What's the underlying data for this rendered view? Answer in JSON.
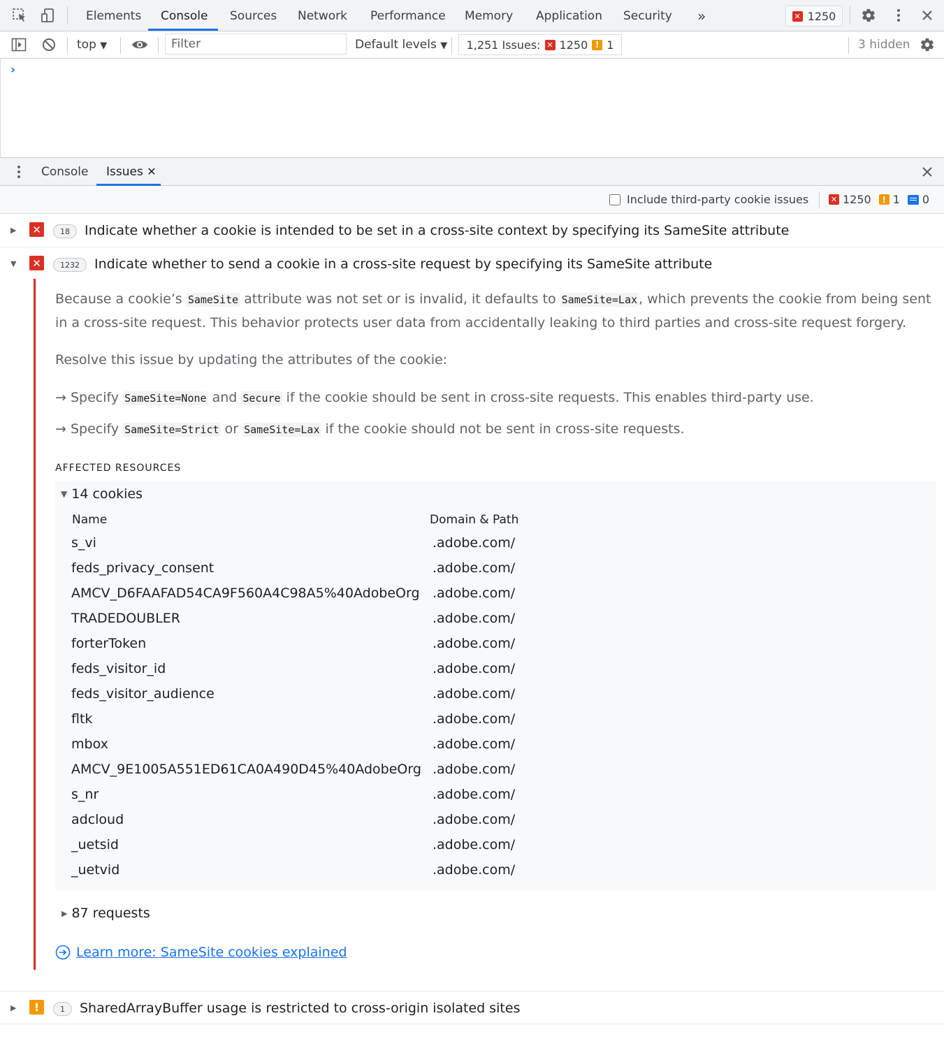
{
  "tabs": [
    {
      "label": "Elements"
    },
    {
      "label": "Console"
    },
    {
      "label": "Sources"
    },
    {
      "label": "Network"
    },
    {
      "label": "Performance"
    },
    {
      "label": "Memory"
    },
    {
      "label": "Application"
    },
    {
      "label": "Security"
    }
  ],
  "active_tab": "Console",
  "error_badge_count": "1250",
  "toolbar": {
    "context": "top",
    "filter_placeholder": "Filter",
    "levels": "Default levels",
    "issues_label": "1,251 Issues:",
    "issues_errors": "1250",
    "issues_warnings": "1",
    "hidden": "3 hidden"
  },
  "drawer": {
    "tabs": [
      {
        "label": "Console"
      },
      {
        "label": "Issues"
      }
    ],
    "active_tab": "Issues",
    "include_label": "Include third-party cookie issues",
    "count_errors": "1250",
    "count_warnings": "1",
    "count_info": "0"
  },
  "issues": [
    {
      "count": "18",
      "title": "Indicate whether a cookie is intended to be set in a cross-site context by specifying its SameSite attribute",
      "severity": "error",
      "expanded": false
    },
    {
      "count": "1232",
      "title": "Indicate whether to send a cookie in a cross-site request by specifying its SameSite attribute",
      "severity": "error",
      "expanded": true
    },
    {
      "count": "1",
      "title": "SharedArrayBuffer usage is restricted to cross-origin isolated sites",
      "severity": "warning",
      "expanded": false
    }
  ],
  "detail": {
    "p1_a": "Because a cookie’s ",
    "p1_code1": "SameSite",
    "p1_b": " attribute was not set or is invalid, it defaults to ",
    "p1_code2": "SameSite=Lax",
    "p1_c": ", which prevents the cookie from being sent in a cross-site request. This behavior protects user data from accidentally leaking to third parties and cross-site request forgery.",
    "p2": "Resolve this issue by updating the attributes of the cookie:",
    "b1_a": "→ Specify ",
    "b1_code1": "SameSite=None",
    "b1_b": " and ",
    "b1_code2": "Secure",
    "b1_c": " if the cookie should be sent in cross-site requests. This enables third-party use.",
    "b2_a": "→ Specify ",
    "b2_code1": "SameSite=Strict",
    "b2_b": " or ",
    "b2_code2": "SameSite=Lax",
    "b2_c": " if the cookie should not be sent in cross-site requests.",
    "affected_heading": "AFFECTED RESOURCES",
    "cookies_label": "14 cookies",
    "col_name": "Name",
    "col_domain": "Domain & Path",
    "cookies": [
      {
        "name": "s_vi",
        "domain": ".adobe.com/"
      },
      {
        "name": "feds_privacy_consent",
        "domain": ".adobe.com/"
      },
      {
        "name": "AMCV_D6FAAFAD54CA9F560A4C98A5%40AdobeOrg",
        "domain": ".adobe.com/"
      },
      {
        "name": "TRADEDOUBLER",
        "domain": ".adobe.com/"
      },
      {
        "name": "forterToken",
        "domain": ".adobe.com/"
      },
      {
        "name": "feds_visitor_id",
        "domain": ".adobe.com/"
      },
      {
        "name": "feds_visitor_audience",
        "domain": ".adobe.com/"
      },
      {
        "name": "fltk",
        "domain": ".adobe.com/"
      },
      {
        "name": "mbox",
        "domain": ".adobe.com/"
      },
      {
        "name": "AMCV_9E1005A551ED61CA0A490D45%40AdobeOrg",
        "domain": ".adobe.com/"
      },
      {
        "name": "s_nr",
        "domain": ".adobe.com/"
      },
      {
        "name": "adcloud",
        "domain": ".adobe.com/"
      },
      {
        "name": "_uetsid",
        "domain": ".adobe.com/"
      },
      {
        "name": "_uetvid",
        "domain": ".adobe.com/"
      }
    ],
    "requests_label": "87 requests",
    "learn_more": "Learn more: SameSite cookies explained"
  },
  "colors": {
    "accent": "#1a73e8",
    "error": "#d93025",
    "warning": "#f29900"
  }
}
